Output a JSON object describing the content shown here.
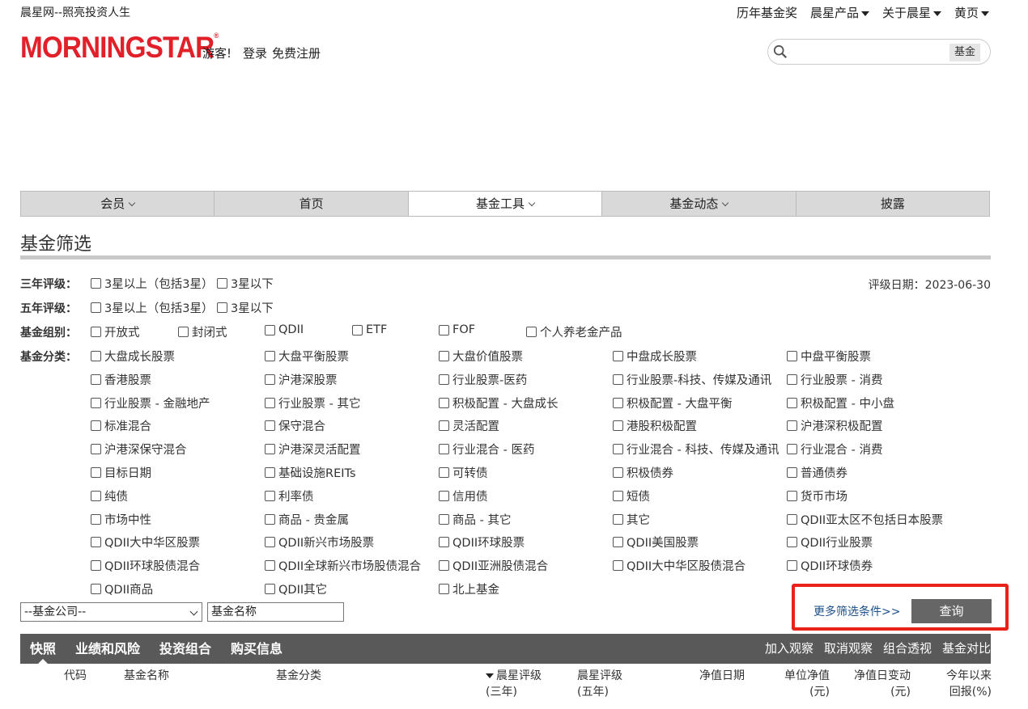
{
  "header": {
    "slogan": "晨星网--照亮投资人生",
    "nav": [
      "历年基金奖",
      "晨星产品",
      "关于晨星",
      "黄页"
    ],
    "logo_text": "MORNINGSTAR",
    "guest": "游客!",
    "login": "登录",
    "register": "免费注册",
    "search": {
      "placeholder": "",
      "button": "基金"
    }
  },
  "main_nav": [
    {
      "label": "会员",
      "dropdown": true
    },
    {
      "label": "首页",
      "dropdown": false
    },
    {
      "label": "基金工具",
      "dropdown": true,
      "active": true
    },
    {
      "label": "基金动态",
      "dropdown": true
    },
    {
      "label": "披露",
      "dropdown": false
    }
  ],
  "page_title": "基金筛选",
  "rating_date": "评级日期：2023-06-30",
  "filters": {
    "three_year": {
      "label": "三年评级：",
      "options": [
        "3星以上（包括3星）",
        "3星以下"
      ]
    },
    "five_year": {
      "label": "五年评级：",
      "options": [
        "3星以上（包括3星）",
        "3星以下"
      ]
    },
    "group": {
      "label": "基金组别：",
      "options": [
        "开放式",
        "封闭式",
        "QDII",
        "ETF",
        "FOF",
        "个人养老金产品"
      ]
    },
    "category": {
      "label": "基金分类：",
      "options": [
        "大盘成长股票",
        "大盘平衡股票",
        "大盘价值股票",
        "中盘成长股票",
        "中盘平衡股票",
        "香港股票",
        "沪港深股票",
        "行业股票-医药",
        "行业股票-科技、传媒及通讯",
        "行业股票 - 消费",
        "行业股票 - 金融地产",
        "行业股票 - 其它",
        "积极配置 - 大盘成长",
        "积极配置 - 大盘平衡",
        "积极配置 - 中小盘",
        "标准混合",
        "保守混合",
        "灵活配置",
        "港股积极配置",
        "沪港深积极配置",
        "沪港深保守混合",
        "沪港深灵活配置",
        "行业混合 - 医药",
        "行业混合 - 科技、传媒及通讯",
        "行业混合 - 消费",
        "目标日期",
        "基础设施REITs",
        "可转债",
        "积极债券",
        "普通债券",
        "纯债",
        "利率债",
        "信用债",
        "短债",
        "货币市场",
        "市场中性",
        "商品 - 贵金属",
        "商品 - 其它",
        "其它",
        "QDII亚太区不包括日本股票",
        "QDII大中华区股票",
        "QDII新兴市场股票",
        "QDII环球股票",
        "QDII美国股票",
        "QDII行业股票",
        "QDII环球股债混合",
        "QDII全球新兴市场股债混合",
        "QDII亚洲股债混合",
        "QDII大中华区股债混合",
        "QDII环球债券",
        "QDII商品",
        "QDII其它",
        "北上基金"
      ]
    },
    "company_select": "--基金公司--",
    "fund_name_value": "基金名称",
    "more_link": "更多筛选条件>>",
    "query_button": "查询"
  },
  "results": {
    "tabs": [
      "快照",
      "业绩和风险",
      "投资组合",
      "购买信息"
    ],
    "active_tab": "快照",
    "actions": [
      "加入观察",
      "取消观察",
      "组合透视",
      "基金对比"
    ],
    "columns": {
      "code": "代码",
      "name": "基金名称",
      "category": "基金分类",
      "rating3_line1": "晨星评级",
      "rating3_line2": "(三年)",
      "rating5_line1": "晨星评级",
      "rating5_line2": "(五年)",
      "nav_date": "净值日期",
      "nav_line1": "单位净值",
      "nav_line2": "(元)",
      "daily_line1": "净值日变动",
      "daily_line2": "(元)",
      "ytd_line1": "今年以来",
      "ytd_line2": "回报(%)"
    }
  },
  "colors": {
    "brand_red": "#e2202a",
    "highlight_red": "#e8221a",
    "result_bar": "#595959",
    "link_blue": "#1a4f8a"
  }
}
